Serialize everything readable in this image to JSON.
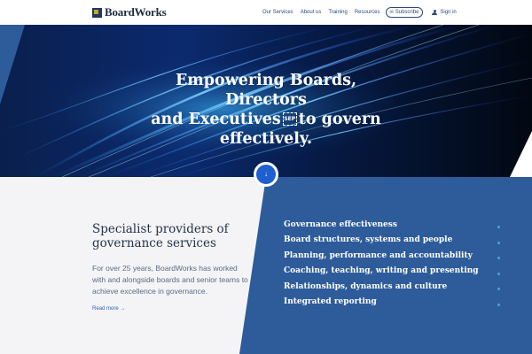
{
  "header": {
    "logo_text": "BoardWorks",
    "nav": [
      "Our Services",
      "About us",
      "Training",
      "Resources"
    ],
    "subscribe_label": "Subscribe",
    "signin_label": "Sign in"
  },
  "hero": {
    "title_line1": "Empowering Boards, Directors",
    "title_line2_pre": "and Executives",
    "sep_glyph": "SEP",
    "title_line2_post": "to govern",
    "title_line3": "effectively.",
    "down_arrow": "↓"
  },
  "intro": {
    "heading": "Specialist providers of governance services",
    "body": "For over 25 years, BoardWorks has worked with and alongside boards and senior teams to achieve excellence in governance.",
    "read_more": "Read more →"
  },
  "services": [
    "Governance effectiveness",
    "Board structures, systems and people",
    "Planning, performance and accountability",
    "Coaching, teaching, writing and presenting",
    "Relationships, dynamics and culture",
    "Integrated reporting"
  ],
  "colors": {
    "brand_navy": "#1e2d40",
    "link_blue": "#2d4a7a",
    "panel_blue": "#2e5c9a",
    "button_blue": "#1e5fd1",
    "dot_blue": "#3ea7e0"
  }
}
